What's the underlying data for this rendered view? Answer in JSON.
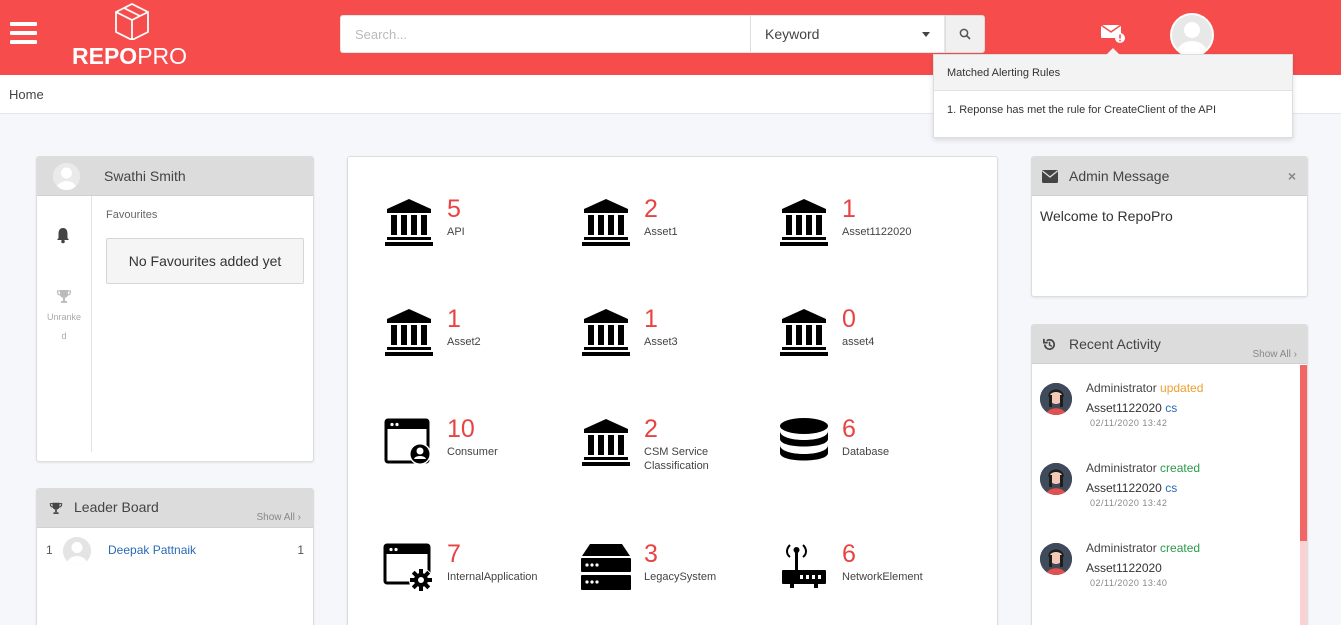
{
  "header": {
    "logo_bold": "REPO",
    "logo_light": "PRO",
    "search_placeholder": "Search...",
    "search_mode": "Keyword"
  },
  "breadcrumb": "Home",
  "alerts": {
    "title": "Matched Alerting Rules",
    "items": [
      "1. Reponse has met the rule for CreateClient of the API"
    ]
  },
  "profile": {
    "name": "Swathi Smith",
    "rank_label": "Unranked",
    "favourites_label": "Favourites",
    "favourites_empty": "No Favourites added yet"
  },
  "leaderboard": {
    "title": "Leader Board",
    "show_all": "Show All",
    "rows": [
      {
        "rank": "1",
        "name": "Deepak Pattnaik",
        "score": "1"
      }
    ]
  },
  "assets": [
    {
      "count": "5",
      "name": "API",
      "icon": "bank-icon"
    },
    {
      "count": "2",
      "name": "Asset1",
      "icon": "bank-icon"
    },
    {
      "count": "1",
      "name": "Asset1122020",
      "icon": "bank-icon"
    },
    {
      "count": "1",
      "name": "Asset2",
      "icon": "bank-icon"
    },
    {
      "count": "1",
      "name": "Asset3",
      "icon": "bank-icon"
    },
    {
      "count": "0",
      "name": "asset4",
      "icon": "bank-icon"
    },
    {
      "count": "10",
      "name": "Consumer",
      "icon": "window-user-icon"
    },
    {
      "count": "2",
      "name": "CSM Service Classification",
      "icon": "bank-icon"
    },
    {
      "count": "6",
      "name": "Database",
      "icon": "database-icon"
    },
    {
      "count": "7",
      "name": "InternalApplication",
      "icon": "window-gear-icon"
    },
    {
      "count": "3",
      "name": "LegacySystem",
      "icon": "server-icon"
    },
    {
      "count": "6",
      "name": "NetworkElement",
      "icon": "router-icon"
    }
  ],
  "admin_message": {
    "title": "Admin Message",
    "text": "Welcome to RepoPro",
    "close": "×"
  },
  "recent_activity": {
    "title": "Recent Activity",
    "show_all": "Show All",
    "items": [
      {
        "user": "Administrator",
        "action": "updated",
        "asset": "Asset1122020",
        "suffix": "cs",
        "time": "02/11/2020 13:42"
      },
      {
        "user": "Administrator",
        "action": "created",
        "asset": "Asset1122020",
        "suffix": "cs",
        "time": "02/11/2020 13:42"
      },
      {
        "user": "Administrator",
        "action": "created",
        "asset": "Asset1122020",
        "suffix": "",
        "time": "02/11/2020 13:40"
      }
    ]
  },
  "colors": {
    "brand": "#f64c4c",
    "count": "#e84343",
    "link": "#2a6ab5",
    "updated": "#f0a030",
    "created": "#2b9a4a"
  }
}
